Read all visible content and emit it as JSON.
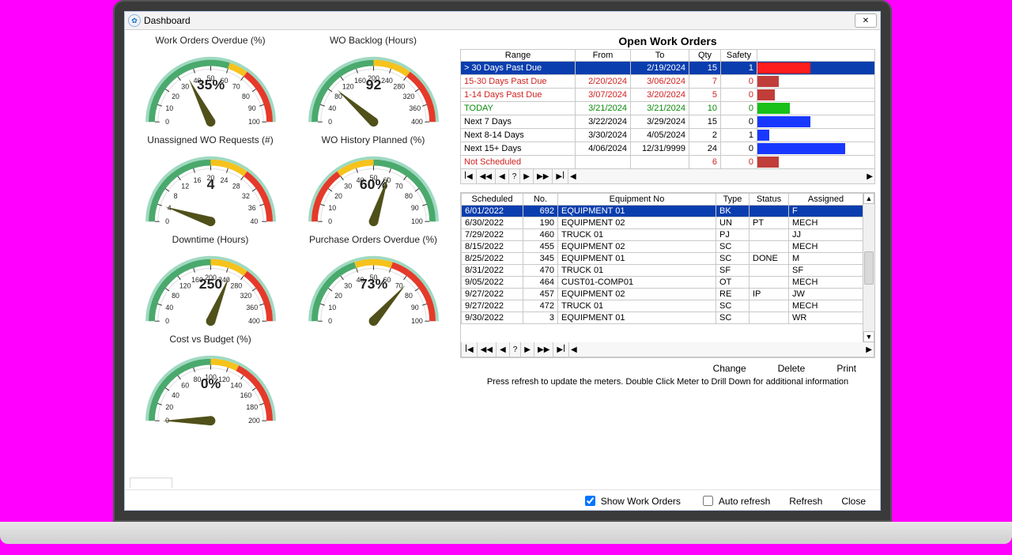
{
  "window": {
    "title": "Dashboard",
    "close": "✕"
  },
  "gauges": [
    {
      "label": "Work Orders Overdue (%)",
      "value_text": "35%",
      "value": 35,
      "min": 0,
      "max": 100,
      "ticks": [
        0,
        10,
        20,
        30,
        40,
        50,
        60,
        70,
        80,
        90,
        100
      ],
      "green_end": 60,
      "yellow_end": 70
    },
    {
      "label": "WO Backlog (Hours)",
      "value_text": "92",
      "value": 92,
      "min": 0,
      "max": 400,
      "ticks": [
        0,
        40,
        80,
        120,
        160,
        200,
        240,
        280,
        320,
        360,
        400
      ],
      "green_end": 200,
      "yellow_end": 280
    },
    {
      "label": "Unassigned WO Requests (#)",
      "value_text": "4",
      "value": 4,
      "min": 0,
      "max": 40,
      "ticks": [
        0,
        4,
        8,
        12,
        16,
        20,
        24,
        28,
        32,
        36,
        40
      ],
      "green_end": 20,
      "yellow_end": 28
    },
    {
      "label": "WO History Planned (%)",
      "value_text": "60%",
      "value": 60,
      "min": 0,
      "max": 100,
      "ticks": [
        0,
        10,
        20,
        30,
        40,
        50,
        60,
        70,
        80,
        90,
        100
      ],
      "invert": true,
      "red_end": 30,
      "yellow_end": 50
    },
    {
      "label": "Downtime (Hours)",
      "value_text": "250",
      "value": 250,
      "min": 0,
      "max": 400,
      "ticks": [
        0,
        40,
        80,
        120,
        160,
        200,
        240,
        280,
        320,
        360,
        400
      ],
      "green_end": 200,
      "yellow_end": 280
    },
    {
      "label": "Purchase Orders Overdue (%)",
      "value_text": "73%",
      "value": 73,
      "min": 0,
      "max": 100,
      "ticks": [
        0,
        10,
        20,
        30,
        40,
        50,
        60,
        70,
        80,
        90,
        100
      ],
      "green_end": 40,
      "yellow_end": 60
    },
    {
      "label": "Cost vs Budget (%)",
      "value_text": "0%",
      "value": 0,
      "min": 0,
      "max": 200,
      "ticks": [
        0,
        20,
        40,
        60,
        80,
        100,
        120,
        140,
        160,
        180,
        200
      ],
      "green_end": 100,
      "yellow_end": 130
    }
  ],
  "open_orders": {
    "title": "Open Work Orders",
    "headers": [
      "Range",
      "From",
      "To",
      "Qty",
      "Safety",
      ""
    ],
    "rows": [
      {
        "range": "> 30 Days Past Due",
        "from": "",
        "to": "2/19/2024",
        "qty": "15",
        "safety": "1",
        "bar": {
          "w": 45,
          "color": "#ff1c1c"
        },
        "cls": "selected"
      },
      {
        "range": "15-30 Days Past Due",
        "from": "2/20/2024",
        "to": "3/06/2024",
        "qty": "7",
        "safety": "0",
        "bar": {
          "w": 18,
          "color": "#c03d3a"
        },
        "red": true
      },
      {
        "range": "1-14 Days Past Due",
        "from": "3/07/2024",
        "to": "3/20/2024",
        "qty": "5",
        "safety": "0",
        "bar": {
          "w": 15,
          "color": "#c03d3a"
        },
        "red": true
      },
      {
        "range": "TODAY",
        "from": "3/21/2024",
        "to": "3/21/2024",
        "qty": "10",
        "safety": "0",
        "bar": {
          "w": 28,
          "color": "#18c018"
        },
        "green": true
      },
      {
        "range": "Next 7 Days",
        "from": "3/22/2024",
        "to": "3/29/2024",
        "qty": "15",
        "safety": "0",
        "bar": {
          "w": 45,
          "color": "#1838ff"
        }
      },
      {
        "range": "Next 8-14 Days",
        "from": "3/30/2024",
        "to": "4/05/2024",
        "qty": "2",
        "safety": "1",
        "bar": {
          "w": 10,
          "color": "#1838ff"
        }
      },
      {
        "range": "Next 15+ Days",
        "from": "4/06/2024",
        "to": "12/31/9999",
        "qty": "24",
        "safety": "0",
        "bar": {
          "w": 75,
          "color": "#1838ff"
        }
      },
      {
        "range": "Not Scheduled",
        "from": "",
        "to": "",
        "qty": "6",
        "safety": "0",
        "bar": {
          "w": 18,
          "color": "#c03d3a"
        },
        "red": true
      }
    ]
  },
  "chart_data": {
    "type": "bar",
    "categories": [
      "> 30 Days Past Due",
      "15-30 Days Past Due",
      "1-14 Days Past Due",
      "TODAY",
      "Next 7 Days",
      "Next 8-14 Days",
      "Next 15+ Days",
      "Not Scheduled"
    ],
    "values": [
      15,
      7,
      5,
      10,
      15,
      2,
      24,
      6
    ],
    "colors": [
      "#ff1c1c",
      "#c03d3a",
      "#c03d3a",
      "#18c018",
      "#1838ff",
      "#1838ff",
      "#1838ff",
      "#c03d3a"
    ],
    "title": "Open Work Orders"
  },
  "wotable": {
    "headers": [
      "Scheduled",
      "No.",
      "Equipment No",
      "Type",
      "Status",
      "Assigned"
    ],
    "rows": [
      [
        "6/01/2022",
        "692",
        "EQUIPMENT 01",
        "BK",
        "",
        "F"
      ],
      [
        "6/30/2022",
        "190",
        "EQUIPMENT 02",
        "UN",
        "PT",
        "MECH"
      ],
      [
        "7/29/2022",
        "460",
        "TRUCK 01",
        "PJ",
        "",
        "JJ"
      ],
      [
        "8/15/2022",
        "455",
        "EQUIPMENT 02",
        "SC",
        "",
        "MECH"
      ],
      [
        "8/25/2022",
        "345",
        "EQUIPMENT 01",
        "SC",
        "DONE",
        "M"
      ],
      [
        "8/31/2022",
        "470",
        "TRUCK 01",
        "SF",
        "",
        "SF"
      ],
      [
        "9/05/2022",
        "464",
        "CUST01-COMP01",
        "OT",
        "",
        "MECH"
      ],
      [
        "9/27/2022",
        "457",
        "EQUIPMENT 02",
        "RE",
        "IP",
        "JW"
      ],
      [
        "9/27/2022",
        "472",
        "TRUCK 01",
        "SC",
        "",
        "MECH"
      ],
      [
        "9/30/2022",
        "3",
        "EQUIPMENT 01",
        "SC",
        "",
        "WR"
      ]
    ],
    "selected": 0
  },
  "actions": {
    "change": "Change",
    "delete": "Delete",
    "print": "Print"
  },
  "hint": "Press refresh to update the meters.   Double Click Meter to Drill Down for additional information",
  "footer": {
    "show_wo": {
      "label": "Show Work Orders",
      "checked": true
    },
    "auto": {
      "label": "Auto refresh",
      "checked": false
    },
    "refresh": "Refresh",
    "close": "Close"
  }
}
